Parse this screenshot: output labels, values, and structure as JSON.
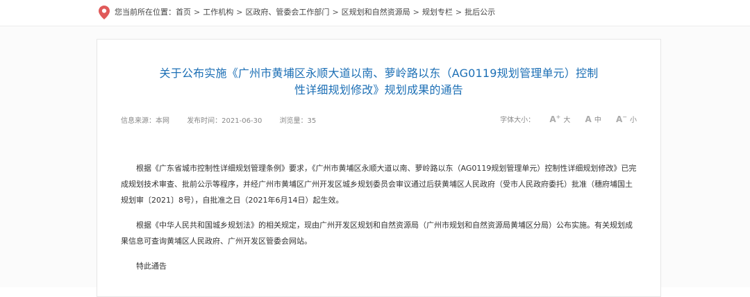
{
  "breadcrumb": {
    "prefix": "您当前所在位置：",
    "items": [
      "首页",
      "工作机构",
      "区政府、管委会工作部门",
      "区规划和自然资源局",
      "规划专栏",
      "批后公示"
    ],
    "separator": ">"
  },
  "article": {
    "title_line1": "关于公布实施《广州市黄埔区永顺大道以南、萝岭路以东（AG0119规划管理单元）控制",
    "title_line2": "性详细规划修改》规划成果的通告",
    "meta": {
      "source": "信息来源：本网",
      "published": "发布时间：2021-06-30",
      "views": "浏览量：35"
    },
    "font_size": {
      "label": "字体大小：",
      "large": "大",
      "medium": "中",
      "small": "小"
    },
    "paragraphs": [
      "根据《广东省城市控制性详细规划管理条例》要求，《广州市黄埔区永顺大道以南、萝岭路以东（AG0119规划管理单元）控制性详细规划修改》已完成规划技术审查、批前公示等程序，并经广州市黄埔区广州开发区城乡规划委员会审议通过后获黄埔区人民政府（受市人民政府委托）批准（穗府埔国土规划审〔2021〕8号），自批准之日（2021年6月14日）起生效。",
      "根据《中华人民共和国城乡规划法》的相关规定，现由广州开发区规划和自然资源局（广州市规划和自然资源局黄埔区分局）公布实施。有关规划成果信息可查询黄埔区人民政府、广州开发区管委会网站。",
      "特此通告"
    ]
  },
  "colors": {
    "title": "#1c6fb5",
    "location_icon": "#e05a5a"
  }
}
